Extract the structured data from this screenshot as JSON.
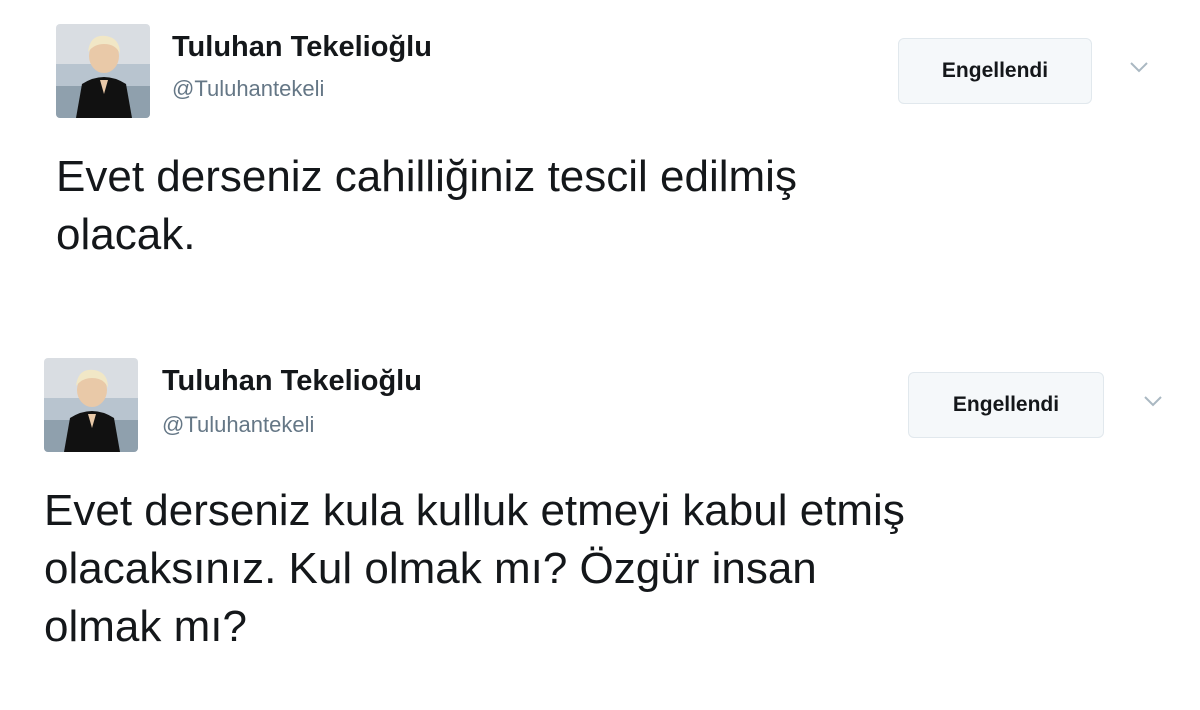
{
  "tweets": [
    {
      "name": "Tuluhan Tekelioğlu",
      "handle": "@Tuluhantekeli",
      "button_label": "Engellendi",
      "text": "Evet derseniz cahilliğiniz tescil edilmiş\nolacak."
    },
    {
      "name": "Tuluhan Tekelioğlu",
      "handle": "@Tuluhantekeli",
      "button_label": "Engellendi",
      "text": "Evet derseniz kula kulluk etmeyi kabul etmiş\nolacaksınız. Kul olmak mı? Özgür insan\nolmak mı?"
    }
  ],
  "colors": {
    "text": "#14171a",
    "secondary": "#657786",
    "button_border": "#e1e8ed",
    "button_bg": "#f5f8fa"
  },
  "icons": {
    "caret": "chevron-down-icon",
    "avatar": "profile-photo"
  }
}
